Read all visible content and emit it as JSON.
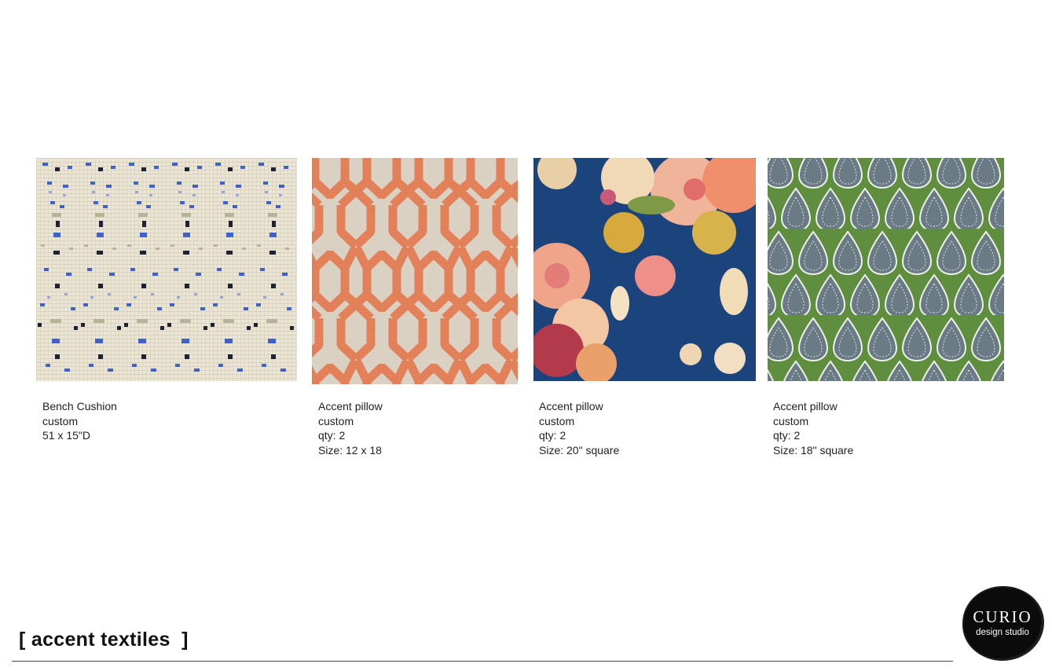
{
  "items": [
    {
      "name": "Bench Cushion",
      "type": "custom",
      "detail": "51 x 15\"D",
      "size": "",
      "pattern": "ikat-icon"
    },
    {
      "name": "Accent pillow",
      "type": "custom",
      "detail": "qty: 2",
      "size": "Size: 12 x 18",
      "pattern": "trellis-icon"
    },
    {
      "name": "Accent pillow",
      "type": "custom",
      "detail": "qty: 2",
      "size": "Size: 20\" square",
      "pattern": "floral-icon"
    },
    {
      "name": "Accent pillow",
      "type": "custom",
      "detail": "qty: 2",
      "size": "Size: 18\" square",
      "pattern": "paisley-icon"
    }
  ],
  "section": {
    "title": "[ accent textiles  ]"
  },
  "logo": {
    "main": "CURIO",
    "sub": "design studio"
  },
  "colors": {
    "ikat_bg": "#ece6d6",
    "ikat_blue": "#3f63c4",
    "ikat_navy": "#1c2333",
    "trellis_bg": "#d9d0c1",
    "trellis_orange": "#e27e56",
    "floral_bg": "#1f4a85",
    "floral_pink": "#f0a58a",
    "floral_gold": "#d8b24a",
    "paisley_bg": "#5f8e3f",
    "paisley_drop": "#6a7b86"
  }
}
